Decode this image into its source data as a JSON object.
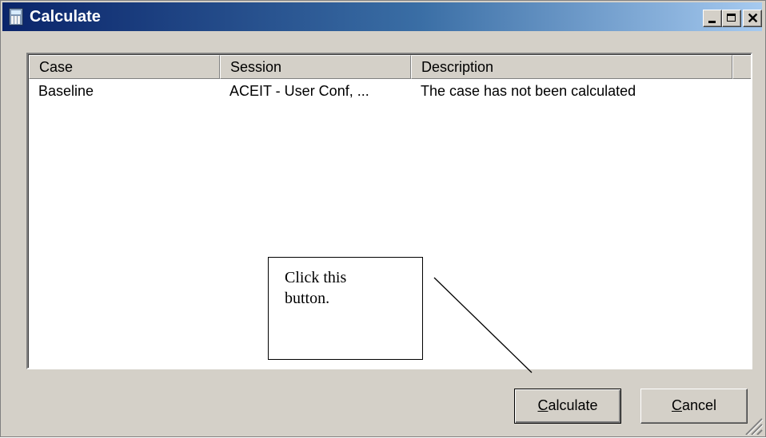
{
  "window": {
    "title": "Calculate"
  },
  "list": {
    "columns": [
      "Case",
      "Session",
      "Description",
      ""
    ],
    "rows": [
      {
        "case": "Baseline",
        "session": "ACEIT - User Conf, ...",
        "description": "The case has not been calculated"
      }
    ]
  },
  "callout": {
    "line1": "Click this",
    "line2": "button."
  },
  "buttons": {
    "calculate": {
      "mnemonic": "C",
      "rest": "alculate"
    },
    "cancel": {
      "mnemonic": "C",
      "rest": "ancel"
    }
  },
  "colors": {
    "titlebar_start": "#0a246a",
    "titlebar_end": "#a6caf0",
    "face": "#d4d0c8"
  }
}
